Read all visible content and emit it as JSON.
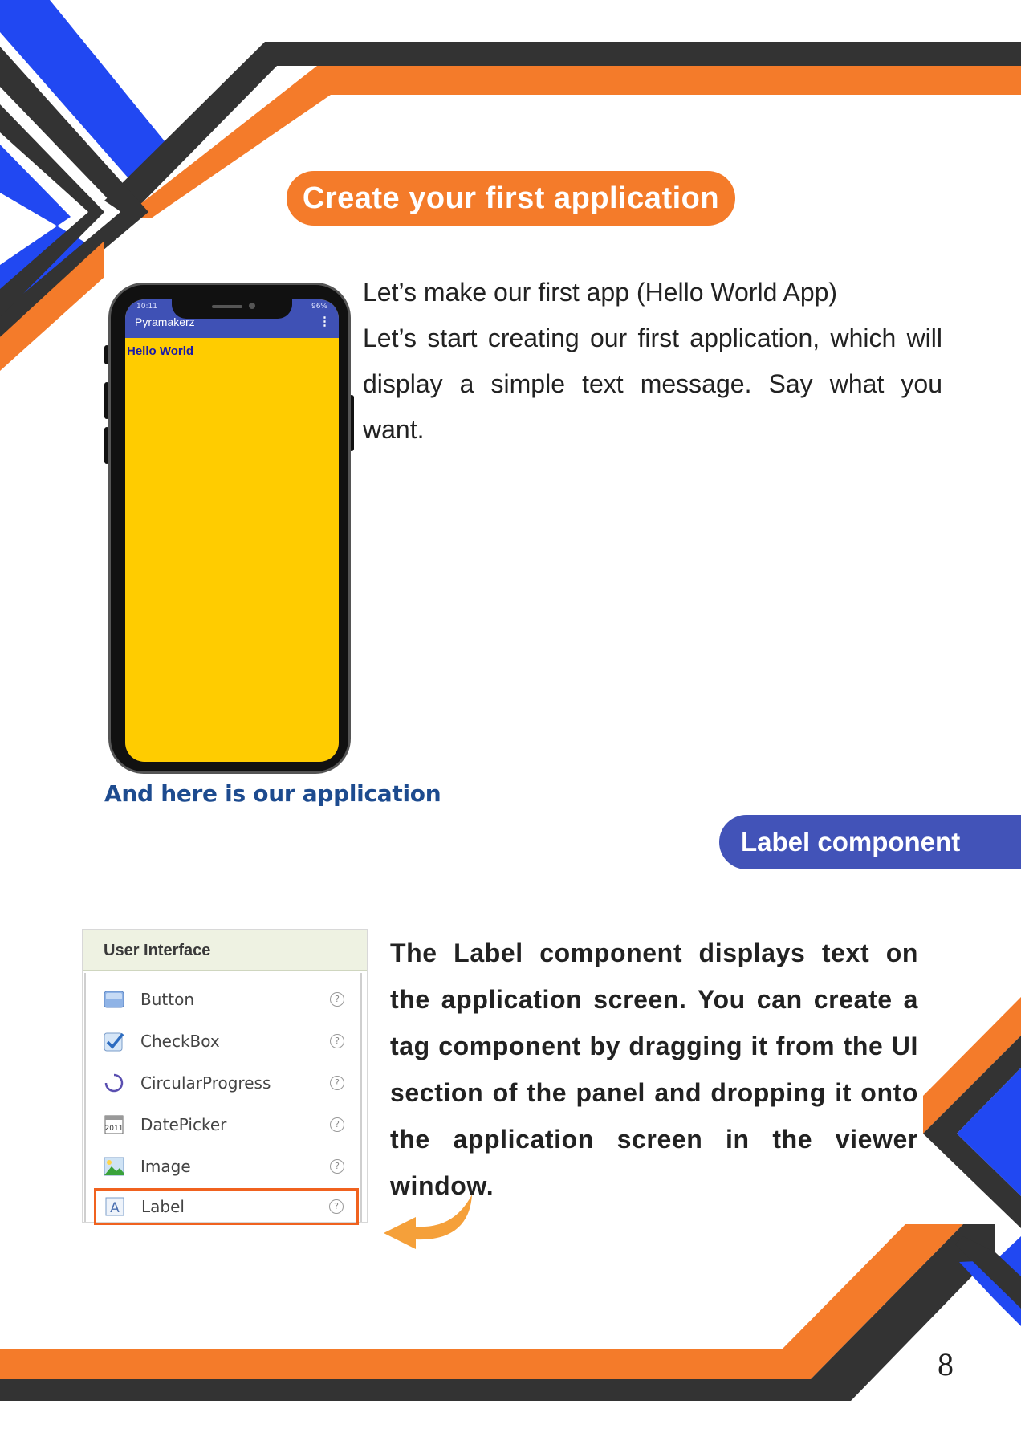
{
  "section_title": "Create your first application",
  "intro": {
    "line1": "Let’s make our first app (Hello World App)",
    "line2": "Let’s start creating our first application, which will display a simple text message. Say what you want."
  },
  "phone": {
    "status_left": "10:11",
    "status_right": "96%",
    "app_title": "Pyramakerz",
    "menu_icon": "⋮",
    "hello_text": "Hello World"
  },
  "caption": "And here is our application",
  "label_section_title": "Label component",
  "palette": {
    "header": "User Interface",
    "items": [
      {
        "label": "Button",
        "icon": "button-icon"
      },
      {
        "label": "CheckBox",
        "icon": "checkbox-icon"
      },
      {
        "label": "CircularProgress",
        "icon": "circular-progress-icon"
      },
      {
        "label": "DatePicker",
        "icon": "datepicker-icon"
      },
      {
        "label": "Image",
        "icon": "image-icon"
      },
      {
        "label": "Label",
        "icon": "label-icon"
      }
    ],
    "help_glyph": "?",
    "highlighted": "Label"
  },
  "description": "The Label component displays text on the application screen. You can create a tag component by dragging it from the UI section of the panel and dropping it onto the application screen in the viewer window.",
  "page_number": "8",
  "colors": {
    "orange": "#f47b2a",
    "blue": "#2148f2",
    "dark": "#333333",
    "indigo": "#4253b8",
    "yellow": "#ffcc00"
  }
}
